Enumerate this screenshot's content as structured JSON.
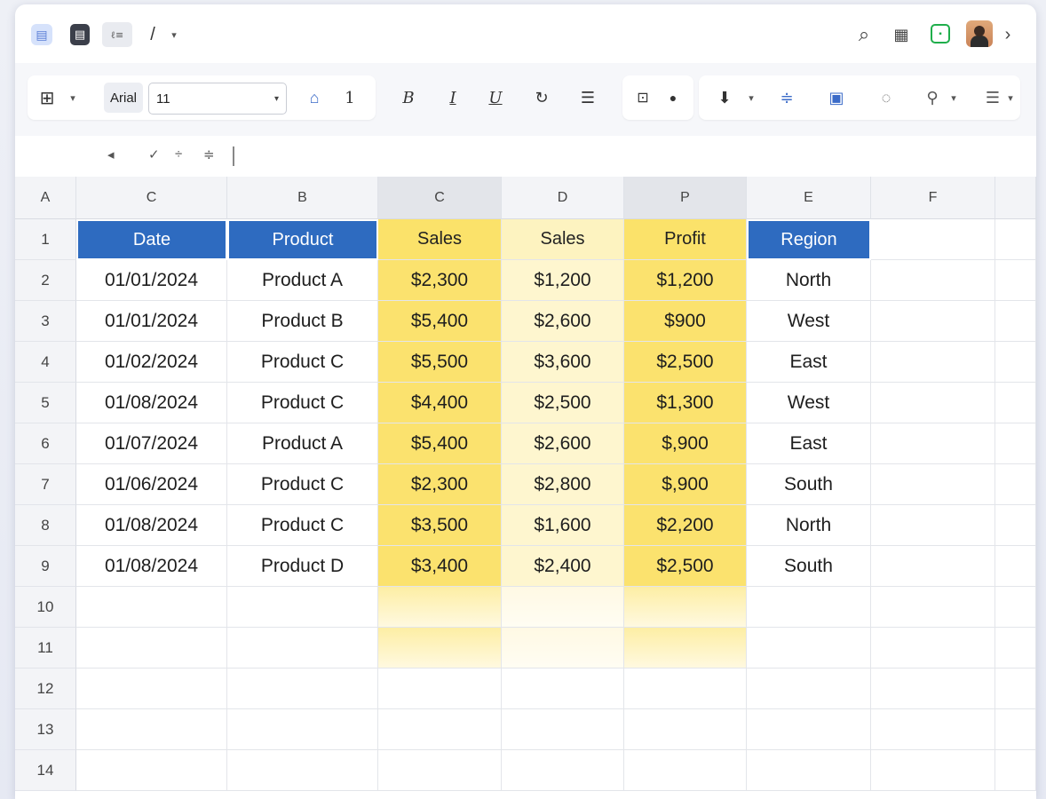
{
  "titlebar": {
    "left_icons": [
      {
        "name": "doc-blue-icon",
        "glyph": "▤",
        "color": "#5b7fd6",
        "bg": "#d6e2fb"
      },
      {
        "name": "doc-dark-icon",
        "glyph": "▤",
        "color": "#ffffff",
        "bg": "#3b3f4a"
      },
      {
        "name": "text-format-icon",
        "glyph": "ℓ≡",
        "color": "#555"
      },
      {
        "name": "pen-icon",
        "glyph": "/",
        "color": "#333"
      }
    ],
    "right_icons": [
      {
        "name": "search-icon",
        "glyph": "⌕"
      },
      {
        "name": "table-view-icon",
        "glyph": "▦"
      },
      {
        "name": "green-doc-icon",
        "glyph": "▣",
        "color": "#1fae4b"
      },
      {
        "name": "user-avatar-icon"
      },
      {
        "name": "chevron-right-icon",
        "glyph": "›"
      }
    ]
  },
  "toolbar": {
    "font_name": "Arial",
    "font_size": "11",
    "bold_glyph": "B",
    "italic_glyph": "I",
    "underline_glyph": "U",
    "count_glyph": "1"
  },
  "formula_bar": {
    "icons": [
      "◂",
      "✓",
      "÷",
      "≑"
    ]
  },
  "columns": [
    "A",
    "C",
    "B",
    "C",
    "D",
    "P",
    "E",
    "F"
  ],
  "headers": [
    "Date",
    "Product",
    "Sales",
    "Sales",
    "Profit",
    "Region"
  ],
  "row_numbers": [
    "1",
    "2",
    "3",
    "4",
    "5",
    "6",
    "7",
    "8",
    "9",
    "10",
    "11",
    "12",
    "13",
    "14"
  ],
  "rows": [
    [
      "01/01/2024",
      "Product A",
      "$2,300",
      "$1,200",
      "$1,200",
      "North"
    ],
    [
      "01/01/2024",
      "Product B",
      "$5,400",
      "$2,600",
      "$900",
      "West"
    ],
    [
      "01/02/2024",
      "Product C",
      "$5,500",
      "$3,600",
      "$2,500",
      "East"
    ],
    [
      "01/08/2024",
      "Product C",
      "$4,400",
      "$2,500",
      "$1,300",
      "West"
    ],
    [
      "01/07/2024",
      "Product A",
      "$5,400",
      "$2,600",
      "$,900",
      "East"
    ],
    [
      "01/06/2024",
      "Product C",
      "$2,300",
      "$2,800",
      "$,900",
      "South"
    ],
    [
      "01/08/2024",
      "Product C",
      "$3,500",
      "$1,600",
      "$2,200",
      "North"
    ],
    [
      "01/08/2024",
      "Product D",
      "$3,400",
      "$2,400",
      "$2,500",
      "South"
    ]
  ],
  "colors": {
    "header_blue": "#2e6bc0",
    "highlight_yellow": "#fbe26e",
    "highlight_pale": "#fef6cf"
  }
}
